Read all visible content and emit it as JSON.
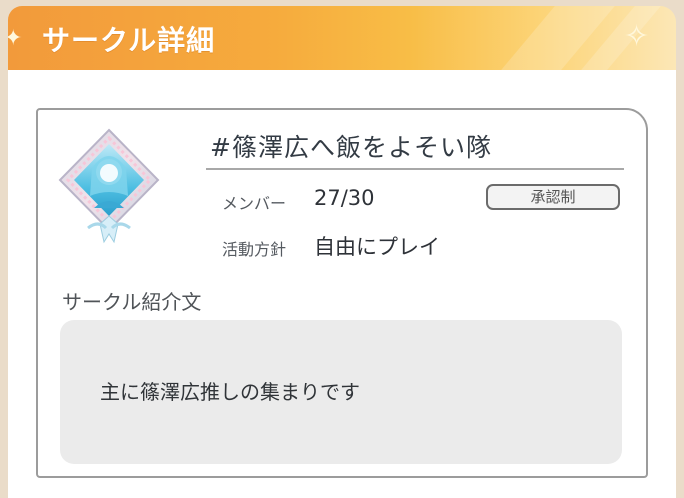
{
  "header": {
    "title": "サークル詳細"
  },
  "circle": {
    "name": "#篠澤広へ飯をよそい隊",
    "member_label": "メンバー",
    "member_count": "27/30",
    "approval_label": "承認制",
    "policy_label": "活動方針",
    "policy_value": "自由にプレイ",
    "emblem_icon": "character-emblem-icon"
  },
  "intro": {
    "label": "サークル紹介文",
    "text": "主に篠澤広推しの集まりです"
  },
  "colors": {
    "header_orange": "#f6ab3d",
    "header_light": "#fce7b6",
    "emblem_cyan": "#5ec8e6",
    "card_border": "#9c9c9c",
    "intro_bg": "#ebebeb"
  }
}
